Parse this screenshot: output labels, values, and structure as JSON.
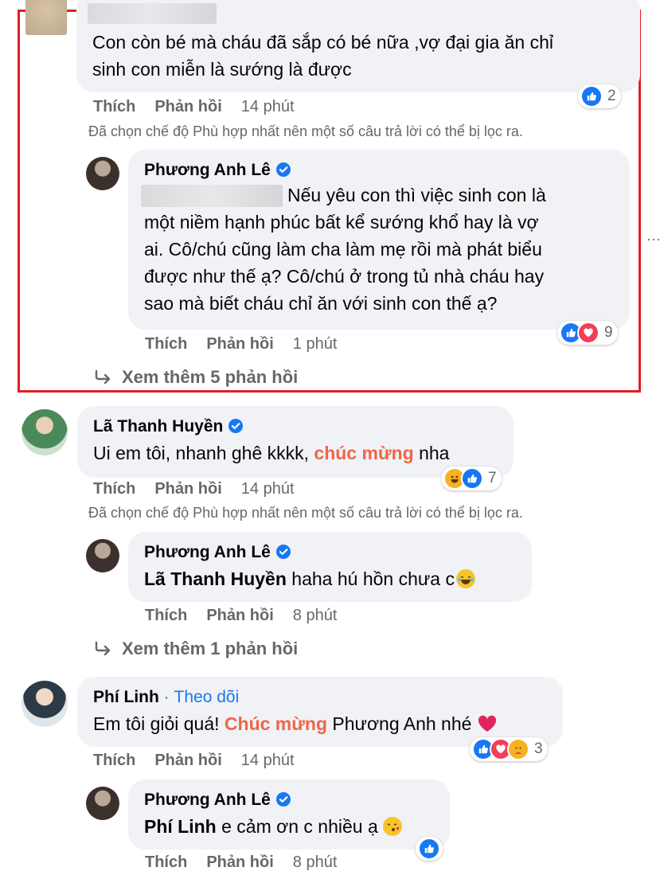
{
  "notice_filter": "Đã chọn chế độ Phù hợp nhất nên một số câu trả lời có thể bị lọc ra.",
  "actions": {
    "like": "Thích",
    "reply": "Phản hồi"
  },
  "comment1": {
    "text_line1": "Con còn bé mà cháu đã sắp có bé nữa ,vợ đại gia ăn chỉ",
    "text_line2": "sinh con miễn là sướng là được",
    "time": "14 phút",
    "reaction_count": "2"
  },
  "reply1": {
    "author": "Phương Anh Lê",
    "line1": "Nếu yêu con thì việc sinh con là",
    "line2": "một niềm hạnh phúc bất kể sướng khổ hay là vợ",
    "line3": "ai. Cô/chú cũng làm cha làm mẹ rồi mà phát biểu",
    "line4": "được như thế ạ? Cô/chú ở trong tủ nhà cháu hay",
    "line5": "sao mà biết cháu chỉ ăn với sinh con thế ạ?",
    "time": "1 phút",
    "reaction_count": "9"
  },
  "more1": "Xem thêm 5 phản hồi",
  "comment2": {
    "author": "Lã Thanh Huyền",
    "text_before": "Ui em tôi, nhanh ghê kkkk,",
    "text_highlight": "chúc mừng",
    "text_after": "nha",
    "time": "14 phút",
    "reaction_count": "7"
  },
  "reply2": {
    "author": "Phương Anh Lê",
    "mention": "Lã Thanh Huyền",
    "text": "haha hú hồn chưa c",
    "time": "8 phút"
  },
  "more2": "Xem thêm 1 phản hồi",
  "comment3": {
    "author": "Phí Linh",
    "separator": "·",
    "follow": "Theo dõi",
    "text_before": "Em tôi giỏi quá!",
    "text_highlight": "Chúc mừng",
    "text_after": "Phương Anh nhé",
    "time": "14 phút",
    "reaction_count": "3"
  },
  "reply3": {
    "author": "Phương Anh Lê",
    "mention": "Phí Linh",
    "text": "e cảm ơn c nhiều ạ",
    "time": "8 phút"
  },
  "colors": {
    "like": "#1877f2",
    "love": "#f33e58",
    "highlight": "#f06548",
    "frame": "#e41e26",
    "follow": "#1877f2"
  }
}
